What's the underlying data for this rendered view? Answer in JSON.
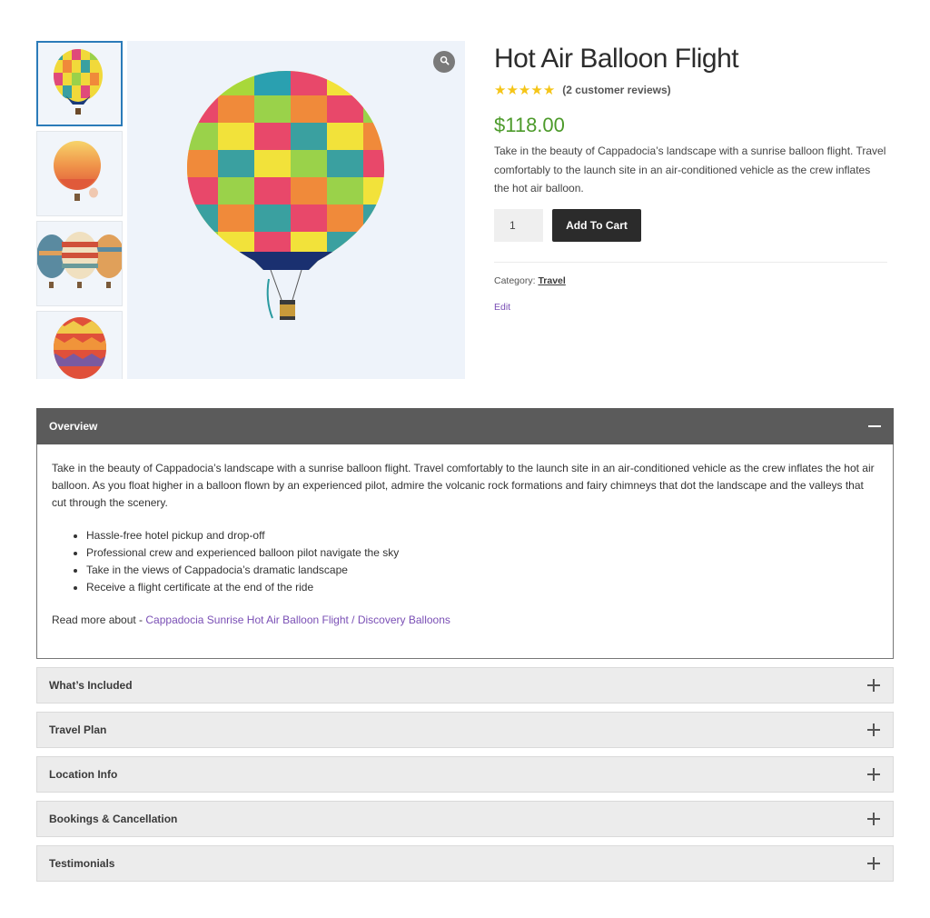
{
  "product": {
    "title": "Hot Air Balloon Flight",
    "rating": 5,
    "rating_max": 5,
    "review_text": "(2 customer reviews)",
    "price": "$118.00",
    "short_description": "Take in the beauty of Cappadocia’s landscape with a sunrise balloon flight. Travel comfortably to the launch site in an air-conditioned vehicle as the crew inflates the hot air balloon.",
    "quantity": "1",
    "add_to_cart_label": "Add To Cart",
    "category_label": "Category:",
    "category_value": "Travel",
    "edit_label": "Edit"
  },
  "gallery": {
    "thumbnail_count": 4,
    "active_thumbnail": 0,
    "zoom_icon": "search-icon"
  },
  "accordion": {
    "open_section": {
      "title": "Overview",
      "icon": "minus-icon",
      "paragraph": "Take in the beauty of Cappadocia’s landscape with a sunrise balloon flight. Travel comfortably to the launch site in an air-conditioned vehicle as the crew inflates the hot air balloon. As you float higher in a balloon flown by an experienced pilot, admire the volcanic rock formations and fairy chimneys that dot the landscape and the valleys that cut through the scenery.",
      "bullets": [
        "Hassle-free hotel pickup and drop-off",
        "Professional crew and experienced balloon pilot navigate the sky",
        "Take in the views of Cappadocia’s dramatic landscape",
        "Receive a flight certificate at the end of the ride"
      ],
      "read_more_prefix": "Read more about - ",
      "read_more_link": "Cappadocia Sunrise Hot Air Balloon Flight / Discovery Balloons"
    },
    "collapsed_sections": [
      {
        "title": "What’s Included",
        "icon": "plus-icon"
      },
      {
        "title": "Travel Plan",
        "icon": "plus-icon"
      },
      {
        "title": "Location Info",
        "icon": "plus-icon"
      },
      {
        "title": "Bookings & Cancellation",
        "icon": "plus-icon"
      },
      {
        "title": "Testimonials",
        "icon": "plus-icon"
      }
    ]
  },
  "colors": {
    "price": "#4c9a2a",
    "star": "#f5c518",
    "link": "#7a4fb5",
    "button": "#2b2b2b",
    "accordion_open": "#5b5b5b",
    "accordion_closed": "#ececec",
    "thumb_active_border": "#2b7bb9"
  }
}
